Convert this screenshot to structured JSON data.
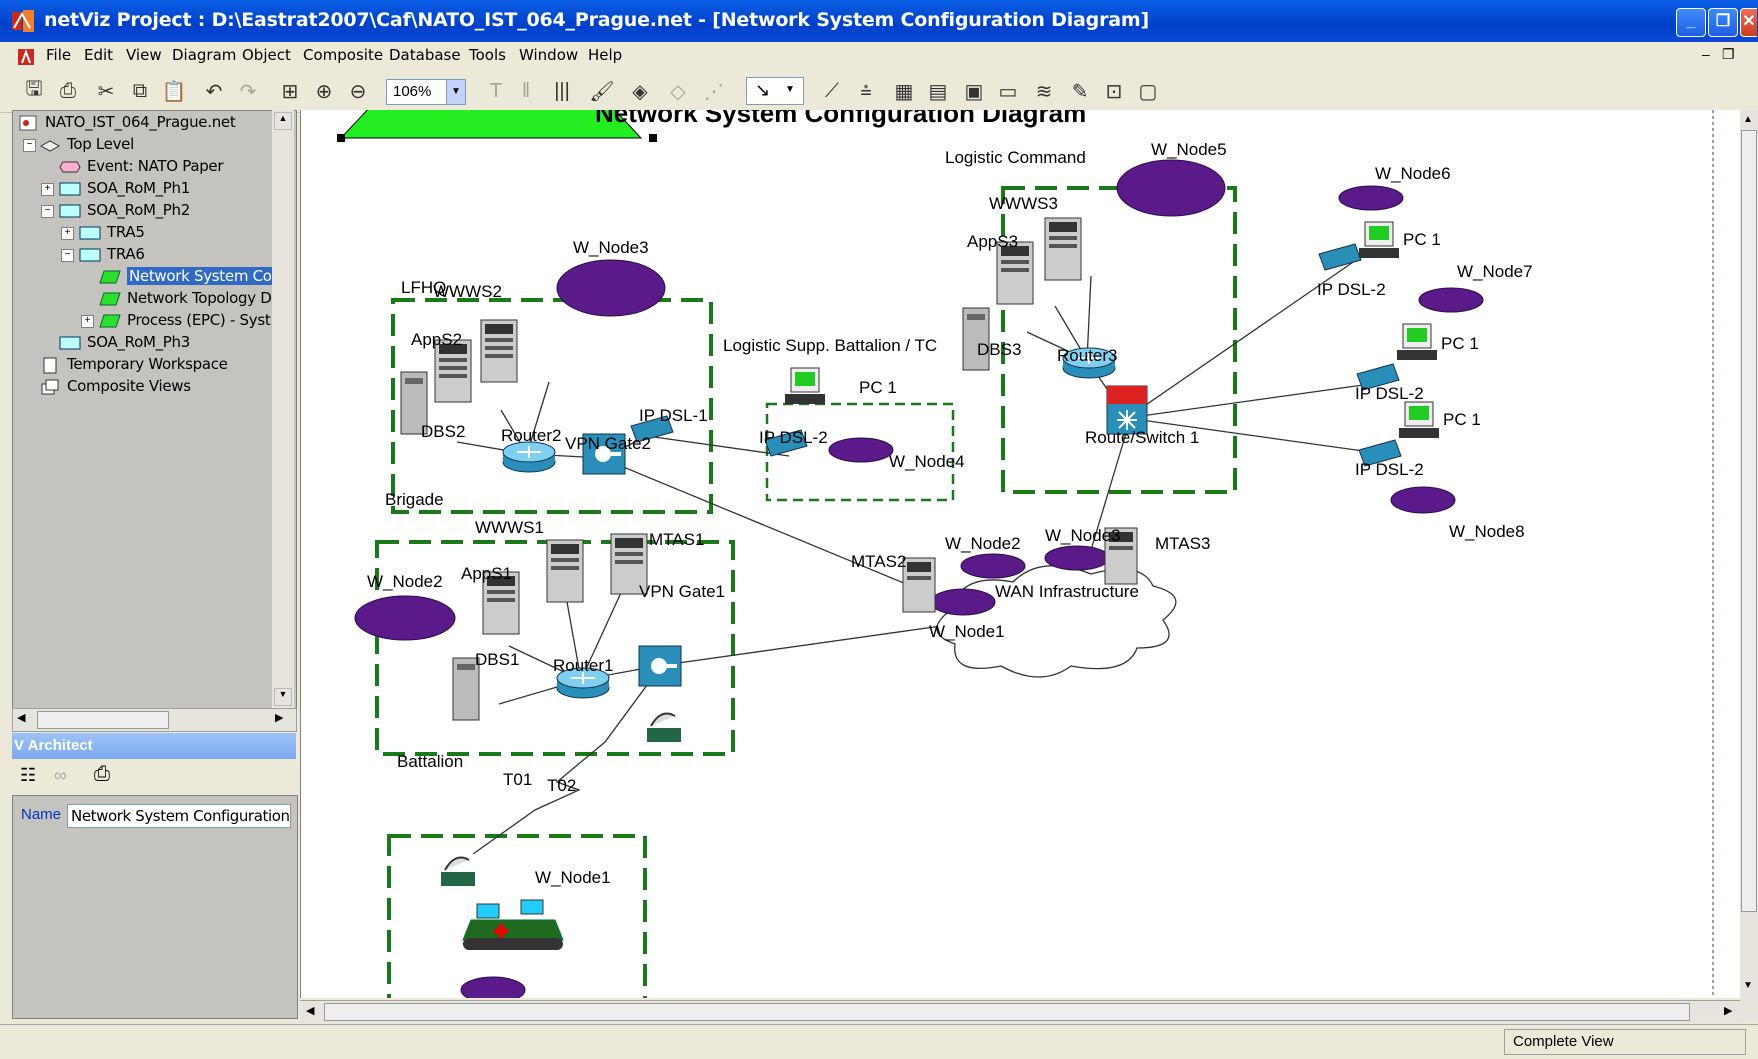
{
  "window": {
    "title": "netViz Project : D:\\Eastrat2007\\Caf\\NATO_IST_064_Prague.net - [Network System  Configuration Diagram]"
  },
  "menu": [
    "File",
    "Edit",
    "View",
    "Diagram",
    "Object",
    "Composite",
    "Database",
    "Tools",
    "Window",
    "Help"
  ],
  "toolbar": {
    "zoom": "106%"
  },
  "tree": {
    "root": "NATO_IST_064_Prague.net",
    "items": [
      {
        "label": "Top Level"
      },
      {
        "label": "Event: NATO Paper"
      },
      {
        "label": "SOA_RoM_Ph1"
      },
      {
        "label": "SOA_RoM_Ph2"
      },
      {
        "label": "TRA5"
      },
      {
        "label": "TRA6"
      },
      {
        "label": "Network System  Co"
      },
      {
        "label": "Network Topology D"
      },
      {
        "label": "Process (EPC) - Syst"
      },
      {
        "label": "SOA_RoM_Ph3"
      },
      {
        "label": "Temporary Workspace"
      },
      {
        "label": "Composite Views"
      }
    ]
  },
  "architect": {
    "header": "V Architect",
    "name_label": "Name",
    "name_value": "Network System  Configuration D"
  },
  "diagram": {
    "title": "Network System  Configuration Diagram",
    "groups": {
      "lfhq": "LFHQ",
      "brigade": "Brigade",
      "battalion": "Battalion",
      "logistic_supp": "Logistic Supp. Battalion / TC",
      "logistic_cmd": "Logistic Command"
    },
    "labels": {
      "wnode3_top": "W_Node3",
      "wwws2": "WWWS2",
      "apps2": "AppS2",
      "dbs2": "DBS2",
      "router2": "Router2",
      "vpngate2": "VPN Gate2",
      "ipdsl1": "IP DSL-1",
      "ipdsl2_sup": "IP DSL-2",
      "pc1_sup": "PC 1",
      "wnode4": "W_Node4",
      "wwws1": "WWWS1",
      "mtas1": "MTAS1",
      "apps1": "AppS1",
      "wnode2_brig": "W_Node2",
      "vpngate1": "VPN Gate1",
      "dbs1": "DBS1",
      "router1": "Router1",
      "t01": "T01",
      "t02": "T02",
      "wnode1_bat": "W_Node1",
      "mtas2": "MTAS2",
      "wnode2": "W_Node2",
      "wnode3": "W_Node3",
      "mtas3": "MTAS3",
      "wan": "WAN Infrastructure",
      "wnode1": "W_Node1",
      "wnode5": "W_Node5",
      "wwws3": "WWWS3",
      "apps3": "AppS3",
      "dbs3": "DBS3",
      "router3": "Router3",
      "routeswitch1": "Route/Switch 1",
      "wnode6": "W_Node6",
      "pc1_a": "PC 1",
      "ipdsl2_a": "IP DSL-2",
      "wnode7": "W_Node7",
      "pc1_b": "PC 1",
      "ipdsl2_b": "IP DSL-2",
      "pc1_c": "PC 1",
      "ipdsl2_c": "IP DSL-2",
      "wnode8": "W_Node8"
    }
  },
  "status": {
    "view": "Complete View"
  },
  "colors": {
    "group_border": "#1a7a1a",
    "ellipse": "#5a1a8a",
    "titlebar": "#0040c8"
  }
}
